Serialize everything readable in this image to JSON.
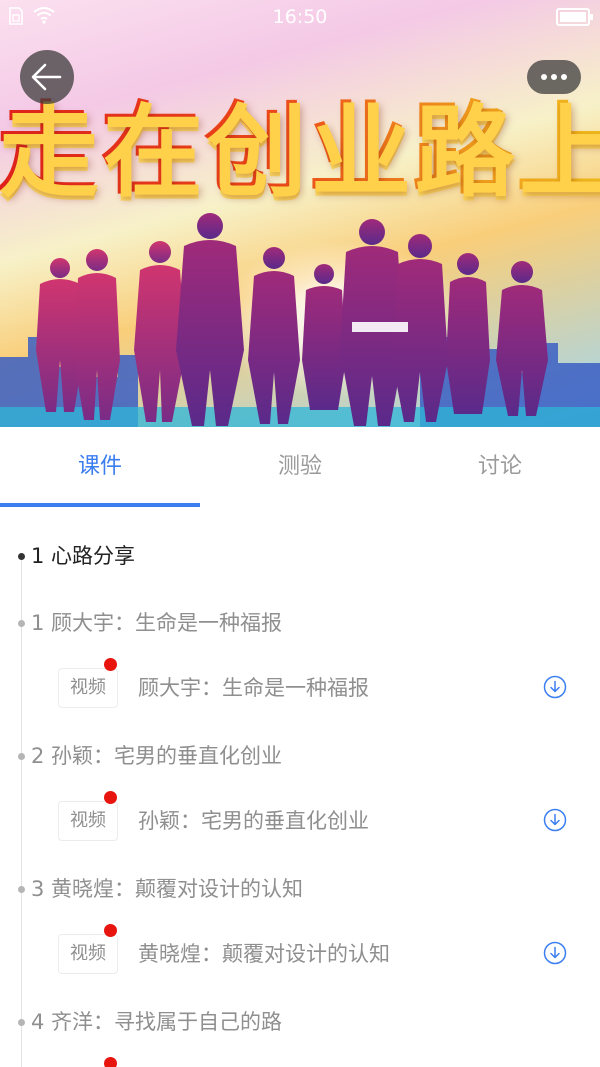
{
  "status_bar": {
    "time": "16:50"
  },
  "banner": {
    "title": "走在创业路上"
  },
  "tabs": [
    {
      "label": "课件",
      "active": true
    },
    {
      "label": "测验",
      "active": false
    },
    {
      "label": "讨论",
      "active": false
    }
  ],
  "outline": {
    "section": {
      "title": "1 心路分享"
    },
    "chapters": [
      {
        "title": "1 顾大宇：生命是一种福报",
        "lesson": {
          "tag": "视频",
          "title": "顾大宇：生命是一种福报"
        }
      },
      {
        "title": "2 孙颖：宅男的垂直化创业",
        "lesson": {
          "tag": "视频",
          "title": "孙颖：宅男的垂直化创业"
        }
      },
      {
        "title": "3 黄晓煌：颠覆对设计的认知",
        "lesson": {
          "tag": "视频",
          "title": "黄晓煌：颠覆对设计的认知"
        }
      },
      {
        "title": "4 齐洋：寻找属于自己的路",
        "lesson": {
          "tag": "",
          "title": ""
        }
      }
    ]
  },
  "colors": {
    "accent": "#3b7ef0",
    "unread_dot": "#e8150f"
  },
  "icons": {
    "back": "arrow-left-icon",
    "more": "more-dots-icon",
    "download": "download-icon"
  }
}
